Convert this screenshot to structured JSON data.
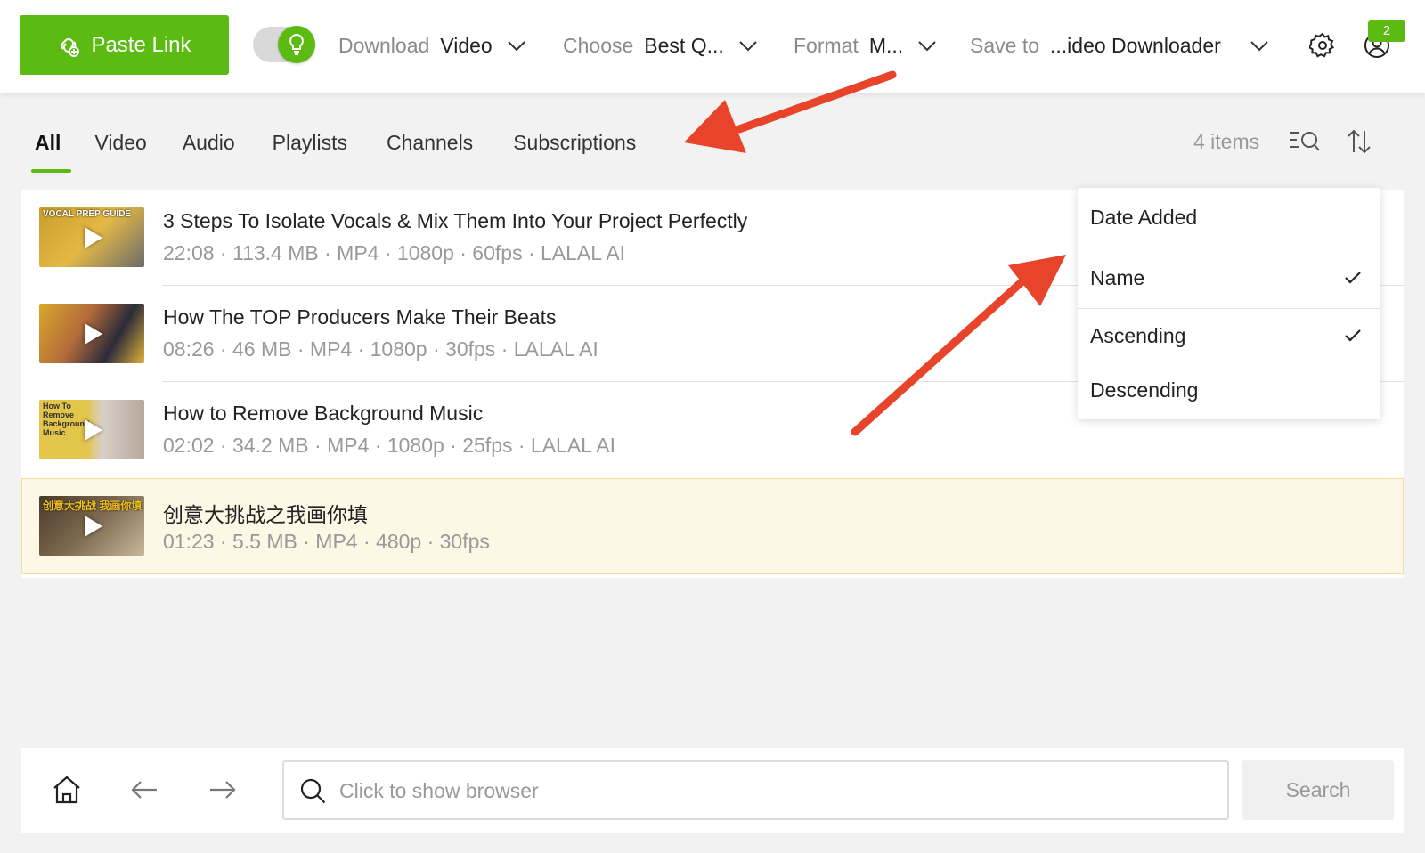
{
  "header": {
    "paste_label": "Paste Link",
    "download": {
      "label": "Download",
      "value": "Video"
    },
    "choose": {
      "label": "Choose",
      "value": "Best Q..."
    },
    "format": {
      "label": "Format",
      "value": "M..."
    },
    "save_to": {
      "label": "Save to",
      "value": "...ideo Downloader"
    },
    "notification_count": "2"
  },
  "tabs": [
    "All",
    "Video",
    "Audio",
    "Playlists",
    "Channels",
    "Subscriptions"
  ],
  "active_tab": "All",
  "items_count": "4 items",
  "sort_menu": {
    "sort_by": [
      {
        "label": "Date Added",
        "checked": false
      },
      {
        "label": "Name",
        "checked": true
      }
    ],
    "order": [
      {
        "label": "Ascending",
        "checked": true
      },
      {
        "label": "Descending",
        "checked": false
      }
    ]
  },
  "items": [
    {
      "title": "3 Steps To Isolate Vocals & Mix Them Into Your Project Perfectly",
      "meta": "22:08 · 113.4 MB · MP4 · 1080p · 60fps · LALAL AI",
      "thumb_caption": "VOCAL PREP GUIDE"
    },
    {
      "title": "How The TOP Producers Make Their Beats",
      "meta": "08:26 · 46 MB · MP4 · 1080p · 30fps · LALAL AI",
      "thumb_caption": ""
    },
    {
      "title": "How to Remove Background Music",
      "meta": "02:02 · 34.2 MB · MP4 · 1080p · 25fps · LALAL AI",
      "thumb_caption": "How To Remove Background Music"
    },
    {
      "title": "创意大挑战之我画你填",
      "meta": "01:23 · 5.5 MB · MP4 · 480p · 30fps",
      "thumb_caption": "创意大挑战 我画你填"
    }
  ],
  "bottom": {
    "search_placeholder": "Click to show browser",
    "search_label": "Search"
  },
  "colors": {
    "accent": "#5bbb12",
    "highlight_row": "#fdf7e6",
    "arrow": "#e8432b"
  }
}
